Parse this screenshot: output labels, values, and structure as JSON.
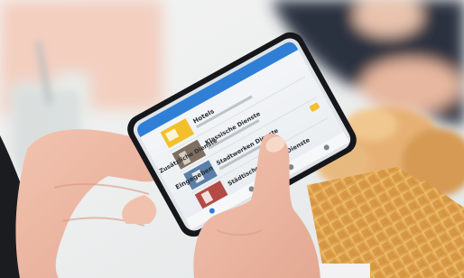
{
  "app": {
    "items": [
      {
        "title": "Hotels"
      },
      {
        "title": "Klassische Dienste"
      },
      {
        "title": "Stadtwerken Dienste"
      },
      {
        "title": "Städtische Zentrale Dienste"
      },
      {
        "title": "Zusätzliche Dienste"
      }
    ],
    "bottom_label": "Eingegeben"
  },
  "colors": {
    "header_blue": "#2f7fd6",
    "badge_yellow": "#f1c02b",
    "phone_body": "#15171b",
    "waffle": "#e0a650",
    "bread": "#d79a55"
  }
}
